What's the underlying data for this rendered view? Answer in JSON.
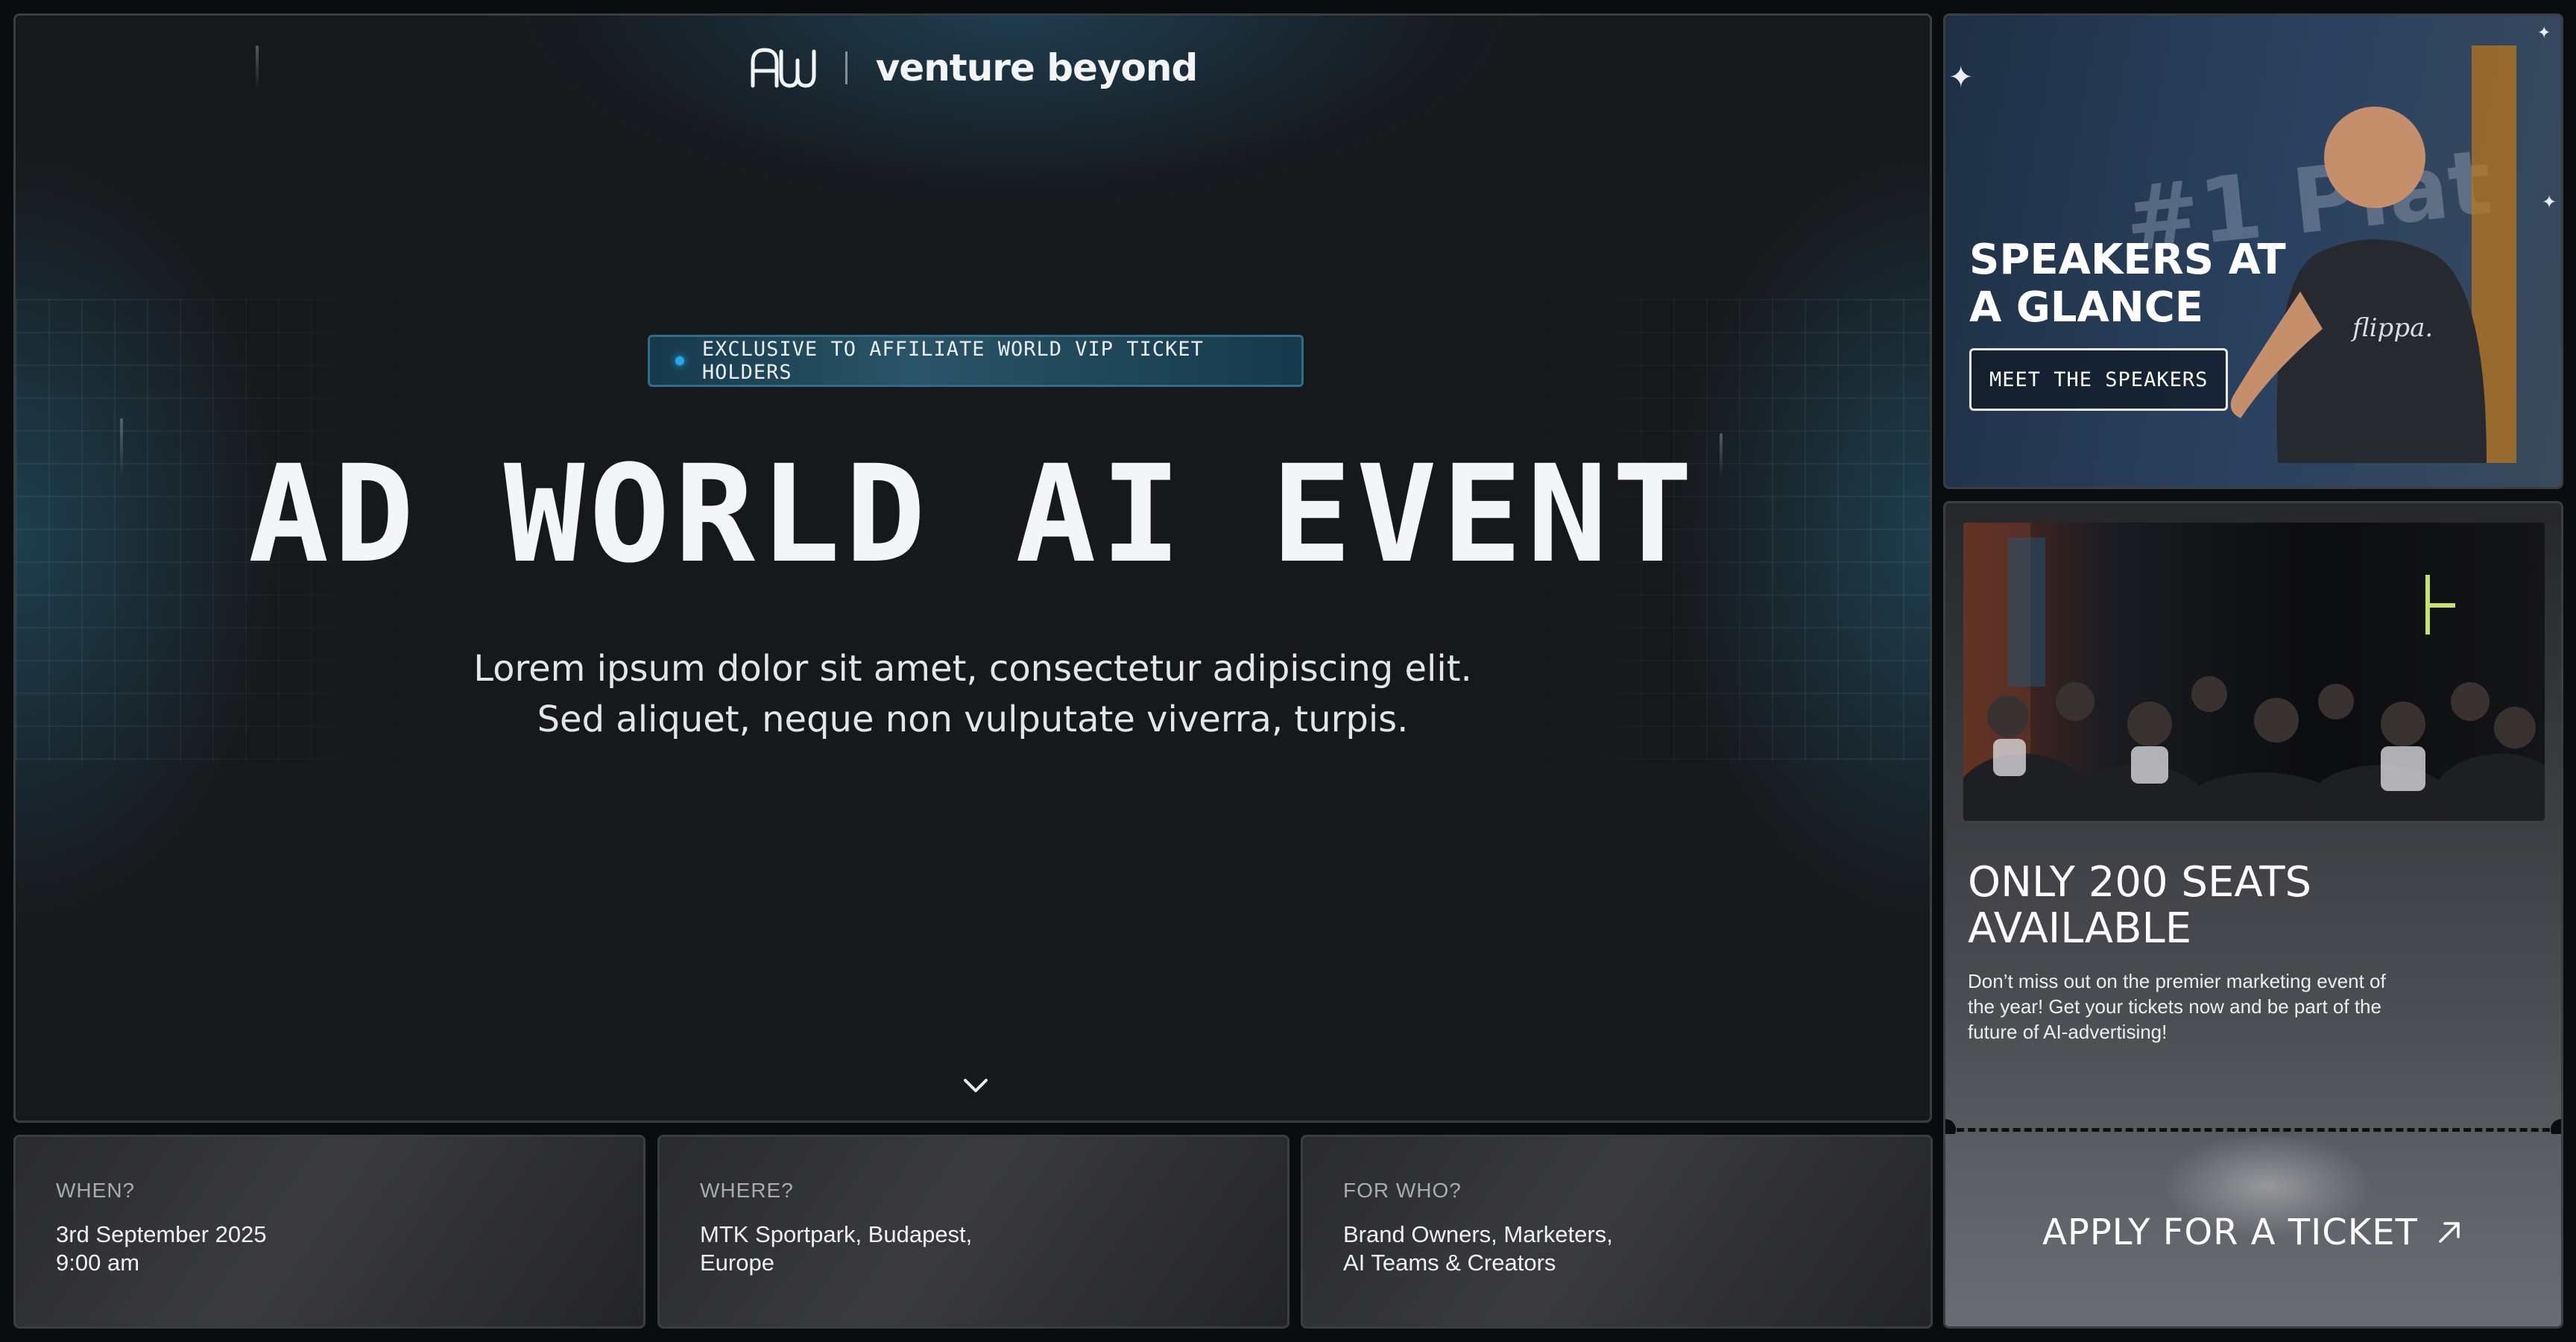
{
  "brand": {
    "mark": "AW",
    "name": "venture beyond"
  },
  "hero": {
    "badge": "EXCLUSIVE TO AFFILIATE WORLD VIP TICKET HOLDERS",
    "title": "AD WORLD AI EVENT",
    "subtitle_line1": "Lorem ipsum dolor sit amet, consectetur adipiscing elit.",
    "subtitle_line2": "Sed aliquet, neque non vulputate viverra, turpis.",
    "scroll_icon": "chevron-down-icon"
  },
  "info": [
    {
      "label": "WHEN?",
      "value_line1": "3rd September 2025",
      "value_line2": "9:00 am"
    },
    {
      "label": "WHERE?",
      "value_line1": "MTK Sportpark, Budapest,",
      "value_line2": "Europe"
    },
    {
      "label": "FOR WHO?",
      "value_line1": "Brand Owners, Marketers,",
      "value_line2": "AI Teams & Creators"
    }
  ],
  "speakers": {
    "title_line1": "SPEAKERS AT",
    "title_line2": "A GLANCE",
    "button": "MEET THE SPEAKERS",
    "backdrop_text": "#1 Plat",
    "shirt_text": "flippa."
  },
  "seats": {
    "title_line1": "ONLY 200 SEATS",
    "title_line2": "AVAILABLE",
    "description": "Don’t miss out on the premier marketing event of the year! Get your tickets now and be part of the future of AI-advertising!",
    "apply_label": "APPLY FOR A TICKET",
    "apply_icon": "arrow-up-right-icon"
  },
  "colors": {
    "accent": "#2aa7e6",
    "background": "#0b0c0e",
    "panel": "#17181b"
  }
}
